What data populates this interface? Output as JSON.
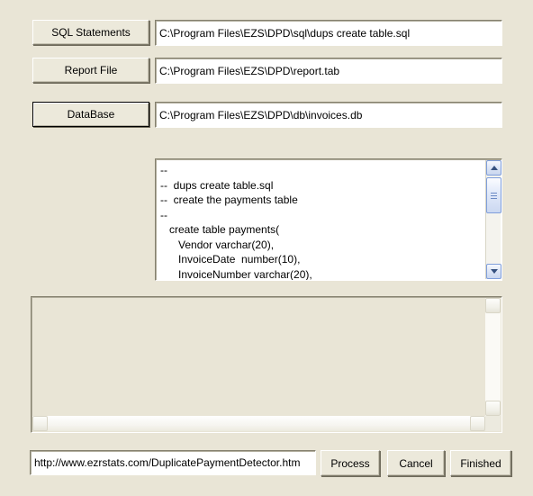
{
  "app": {
    "background_color": "#e9e5d6",
    "button_face_color": "#ece9db"
  },
  "form": {
    "rows": [
      {
        "button_label": "SQL Statements",
        "button_name": "sql-statements-button",
        "is_default": false,
        "field_value": "C:\\Program Files\\EZS\\DPD\\sql\\dups create table.sql",
        "field_name": "sql-statements-path-input"
      },
      {
        "button_label": "Report File",
        "button_name": "report-file-button",
        "is_default": false,
        "field_value": "C:\\Program Files\\EZS\\DPD\\report.tab",
        "field_name": "report-file-path-input"
      },
      {
        "button_label": "DataBase",
        "button_name": "database-button",
        "is_default": true,
        "field_value": "C:\\Program Files\\EZS\\DPD\\db\\invoices.db",
        "field_name": "database-path-input"
      }
    ]
  },
  "sql_editor": {
    "content": "--\n--  dups create table.sql\n--  create the payments table\n--\n   create table payments(\n      Vendor varchar(20),\n      InvoiceDate  number(10),\n      InvoiceNumber varchar(20),",
    "scrollbar": {
      "up_arrow": "scroll-up-icon",
      "down_arrow": "scroll-down-icon"
    }
  },
  "output_console": {
    "content": "",
    "scrollbar": {
      "up_arrow": "scroll-up-icon",
      "down_arrow": "scroll-down-icon",
      "left_arrow": "scroll-left-icon",
      "right_arrow": "scroll-right-icon"
    }
  },
  "footer": {
    "url_value": "http://www.ezrstats.com/DuplicatePaymentDetector.htm",
    "buttons": [
      {
        "label": "Process",
        "name": "process-button"
      },
      {
        "label": "Cancel",
        "name": "cancel-button"
      },
      {
        "label": "Finished",
        "name": "finished-button"
      }
    ]
  }
}
